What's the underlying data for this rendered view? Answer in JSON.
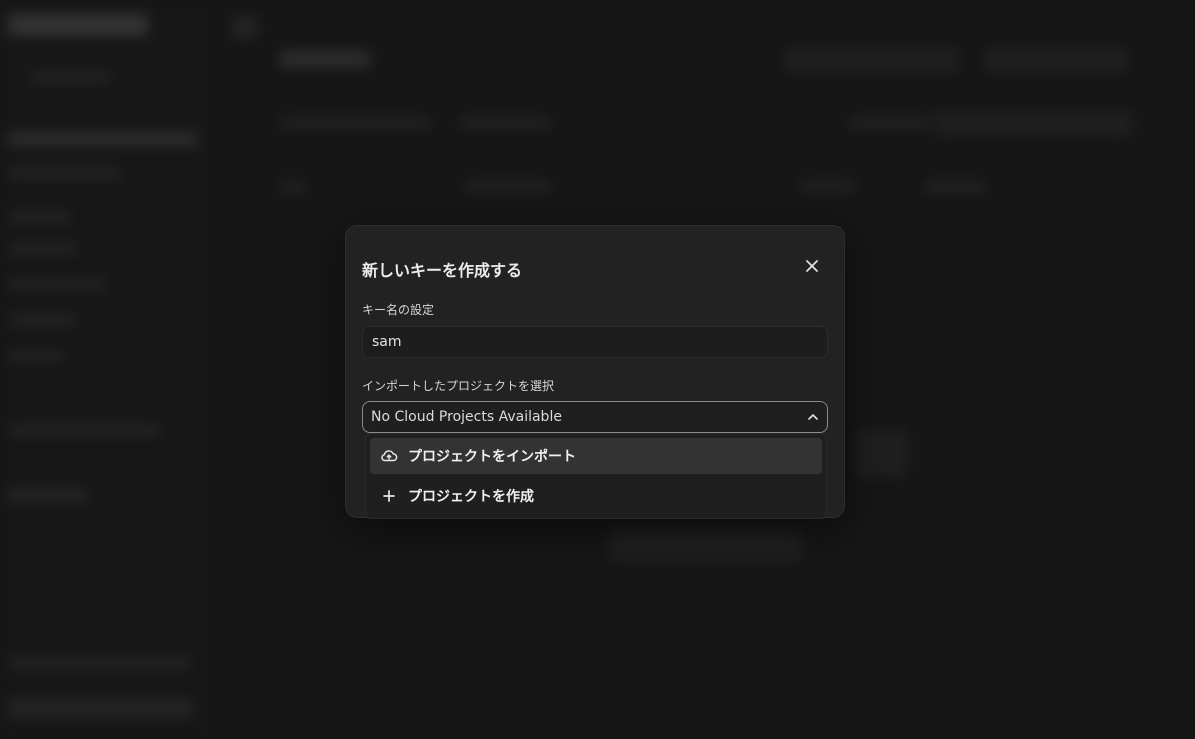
{
  "modal": {
    "title": "新しいキーを作成する",
    "key_name_label": "キー名の設定",
    "key_name_value": "sam",
    "project_label": "インポートしたプロジェクトを選択",
    "project_select_value": "No Cloud Projects Available"
  },
  "dropdown": {
    "items": [
      {
        "label": "プロジェクトをインポート",
        "icon": "cloud-upload-icon",
        "highlighted": true
      },
      {
        "label": "プロジェクトを作成",
        "icon": "plus-icon",
        "highlighted": false
      }
    ]
  },
  "colors": {
    "background": "#1c1c1c",
    "modal": "#222222",
    "dropdown_highlight": "#333333",
    "select_border": "#8a8a8a"
  }
}
